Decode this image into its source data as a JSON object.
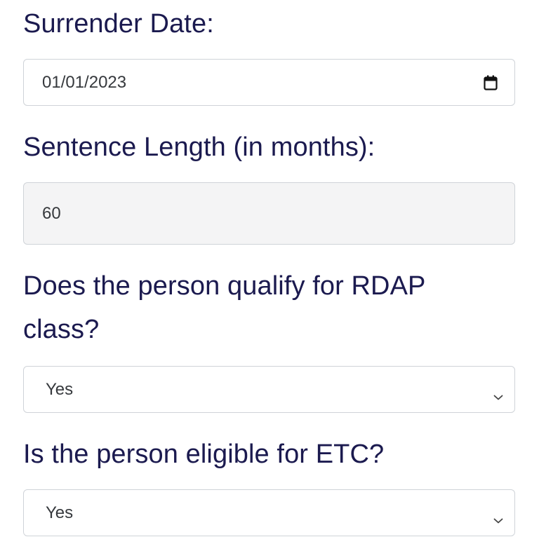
{
  "surrender_date": {
    "label": "Surrender Date:",
    "value": "01/01/2023",
    "icon": "calendar-icon"
  },
  "sentence_length": {
    "label": "Sentence Length (in months):",
    "value": "60"
  },
  "rdap": {
    "label_line1": "Does the person qualify for RDAP",
    "label_line2": "class?",
    "selected": "Yes",
    "icon": "chevron-down-icon"
  },
  "etc": {
    "label": "Is the person eligible for ETC?",
    "selected": "Yes",
    "icon": "chevron-down-icon"
  }
}
